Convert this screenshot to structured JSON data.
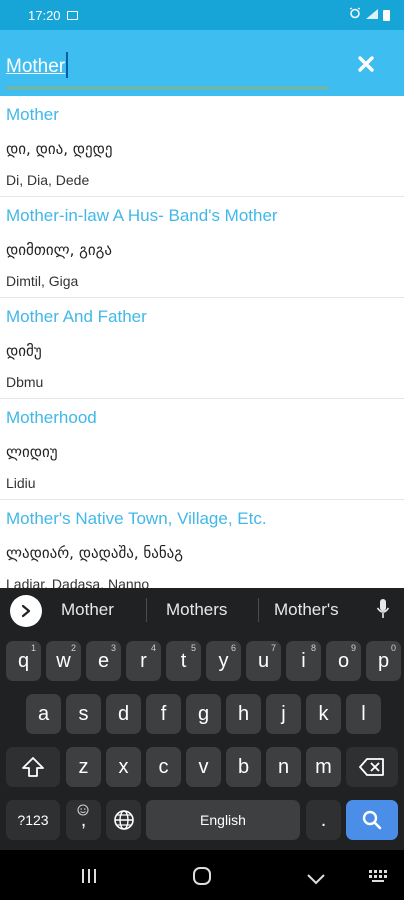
{
  "status_bar": {
    "time": "17:20"
  },
  "search": {
    "value": "Mother"
  },
  "results": [
    {
      "title": "Mother",
      "georgian": "დი, დია, დედე",
      "latin": "Di, Dia, Dede"
    },
    {
      "title": "Mother-in-law A Hus- Band's Mother",
      "georgian": "დიმთილ, გიგა",
      "latin": "Dimtil, Giga"
    },
    {
      "title": "Mother And Father",
      "georgian": "დიმუ",
      "latin": "Dbmu"
    },
    {
      "title": "Motherhood",
      "georgian": "ლიდიუ",
      "latin": "Lidiu"
    },
    {
      "title": "Mother's Native Town, Village, Etc.",
      "georgian": "ლადიარ, დადაშა, ნანაგ",
      "latin": "Ladiar, Dadasa, Nanno"
    }
  ],
  "keyboard": {
    "suggestions": [
      "Mother",
      "Mothers",
      "Mother's"
    ],
    "row1": [
      {
        "k": "q",
        "h": "1"
      },
      {
        "k": "w",
        "h": "2"
      },
      {
        "k": "e",
        "h": "3"
      },
      {
        "k": "r",
        "h": "4"
      },
      {
        "k": "t",
        "h": "5"
      },
      {
        "k": "y",
        "h": "6"
      },
      {
        "k": "u",
        "h": "7"
      },
      {
        "k": "i",
        "h": "8"
      },
      {
        "k": "o",
        "h": "9"
      },
      {
        "k": "p",
        "h": "0"
      }
    ],
    "row2": [
      "a",
      "s",
      "d",
      "f",
      "g",
      "h",
      "j",
      "k",
      "l"
    ],
    "row3": [
      "z",
      "x",
      "c",
      "v",
      "b",
      "n",
      "m"
    ],
    "symbols_label": "?123",
    "space_label": "English",
    "comma_label": ",",
    "period_label": "."
  },
  "colors": {
    "accent": "#41b8e9",
    "header": "#3ebef0",
    "status": "#17a5d8",
    "keyboard_bg": "#1f2123",
    "key": "#3d3f41",
    "action_key": "#4a8ee8"
  }
}
